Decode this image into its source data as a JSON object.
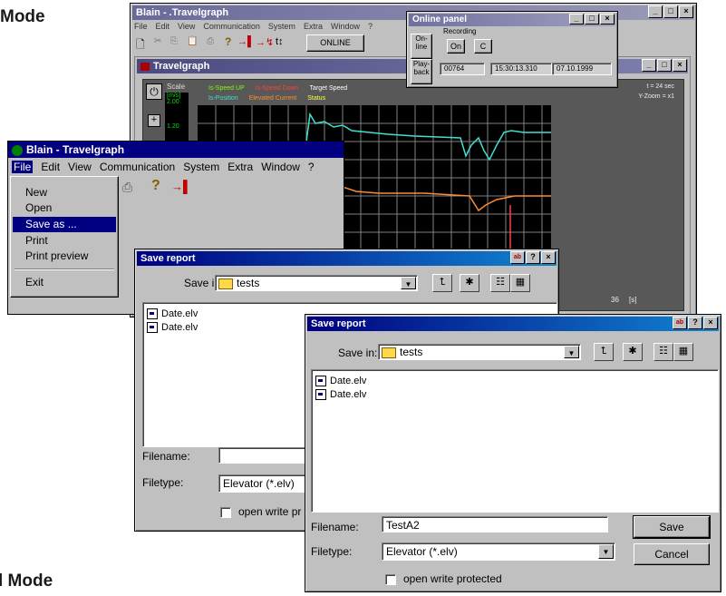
{
  "headings": {
    "top": "Mode",
    "bottom": "l Mode"
  },
  "back_window": {
    "title": "Blain - .Travelgraph",
    "menu": [
      "File",
      "Edit",
      "View",
      "Communication",
      "System",
      "Extra",
      "Window",
      "?"
    ],
    "online_label": "ONLINE",
    "online_panel": {
      "title": "Online panel",
      "online_btn": "On-\nline",
      "recording_label": "Recording",
      "on_btn": "On",
      "c_btn": "C",
      "playback_btn": "Play-\nback",
      "counter": "00764",
      "time": "15:30:13.310",
      "date": "07.10.1999"
    },
    "graph_window": {
      "title": "Travelgraph",
      "scale_label": "Scale",
      "unit": "[m/s]",
      "scale_values": [
        "2.00",
        "1.20"
      ],
      "legend_row1": [
        "Is-Speed UP",
        "Is-Speed Down",
        "Target Speed"
      ],
      "legend_row2": [
        "Is-Position",
        "Elevated Current",
        "Status"
      ],
      "legend_colors": [
        "#7cfc00",
        "#ff4040",
        "#ffffff",
        "#40e0d0",
        "#ff8c30",
        "#ffff40"
      ],
      "t_info": "t = 24 sec",
      "zoom_info": "Y-Zoom = x1",
      "x_end_label": "36",
      "x_unit": "[s]"
    }
  },
  "mid_window": {
    "title": "Blain - Travelgraph",
    "menu": [
      "File",
      "Edit",
      "View",
      "Communication",
      "System",
      "Extra",
      "Window",
      "?"
    ],
    "file_menu": [
      "New",
      "Open",
      "Save as ...",
      "Print",
      "Print preview",
      "Exit"
    ],
    "selected_item": "Save as ..."
  },
  "save_dialog_1": {
    "title": "Save report",
    "save_in_label": "Save in:",
    "save_in_value": "tests",
    "files": [
      "Date.elv",
      "Date.elv"
    ],
    "filename_label": "Filename:",
    "filename_value": "",
    "filetype_label": "Filetype:",
    "filetype_value": "Elevator (*.elv)",
    "protect_label": "open write pr"
  },
  "save_dialog_2": {
    "title": "Save report",
    "save_in_label": "Save in:",
    "save_in_value": "tests",
    "files": [
      "Date.elv",
      "Date.elv"
    ],
    "filename_label": "Filename:",
    "filename_value": "TestA2",
    "filetype_label": "Filetype:",
    "filetype_value": "Elevator (*.elv)",
    "protect_label": "open write protected",
    "save_button": "Save",
    "cancel_button": "Cancel"
  }
}
